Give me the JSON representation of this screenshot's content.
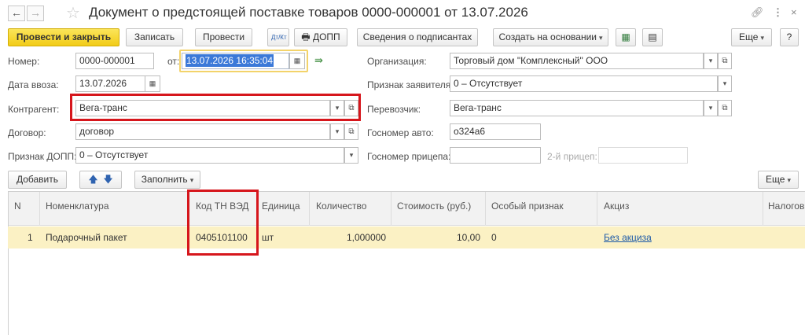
{
  "window": {
    "title": "Документ о предстоящей поставке товаров 0000-000001 от 13.07.2026"
  },
  "toolbar": {
    "post_close": "Провести и закрыть",
    "save": "Записать",
    "post": "Провести",
    "dt_kt": "Дт/Кт",
    "dopp": "ДОПП",
    "signers": "Сведения о подписантах",
    "create_based": "Создать на основании",
    "more": "Еще",
    "help": "?"
  },
  "form": {
    "number_label": "Номер:",
    "number": "0000-000001",
    "from_label": "от:",
    "date": "13.07.2026 16:35:04",
    "import_date_label": "Дата ввоза:",
    "import_date": "13.07.2026",
    "counterparty_label": "Контрагент:",
    "counterparty": "Вега-транс",
    "contract_label": "Договор:",
    "contract": "договор",
    "dopp_sign_label": "Признак ДОПП:",
    "dopp_sign": "0 – Отсутствует",
    "org_label": "Организация:",
    "org": "Торговый дом \"Комплексный\" ООО",
    "applicant_label": "Признак заявителя:",
    "applicant": "0 – Отсутствует",
    "carrier_label": "Перевозчик:",
    "carrier": "Вега-транс",
    "car_number_label": "Госномер авто:",
    "car_number": "о324а6",
    "trailer_label": "Госномер прицепа:",
    "trailer": "",
    "trailer2_label": "2-й прицеп:",
    "trailer2": ""
  },
  "table_toolbar": {
    "add": "Добавить",
    "fill": "Заполнить",
    "more": "Еще"
  },
  "table": {
    "columns": [
      "N",
      "Номенклатура",
      "Код ТН ВЭД",
      "Единица",
      "Количество",
      "Стоимость (руб.)",
      "Особый признак",
      "Акциз",
      "Налогов"
    ],
    "rows": [
      {
        "n": "1",
        "item": "Подарочный пакет",
        "code": "0405101100",
        "unit": "шт",
        "qty": "1,000000",
        "cost": "10,00",
        "special": "0",
        "excise": "Без акциза"
      }
    ]
  }
}
